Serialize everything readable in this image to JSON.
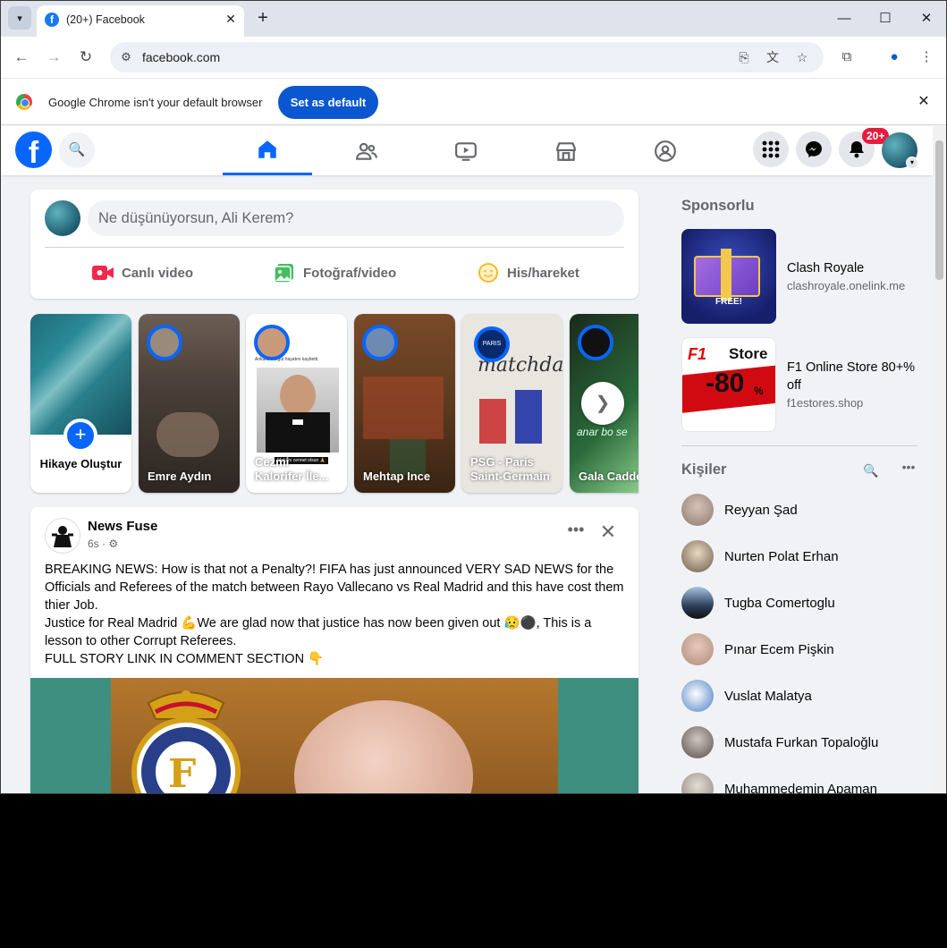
{
  "browser": {
    "tab_title": "(20+) Facebook",
    "url": "facebook.com",
    "infobar_text": "Google Chrome isn't your default browser",
    "set_default_label": "Set as default"
  },
  "facebook": {
    "notification_badge": "20+",
    "composer_placeholder": "Ne düşünüyorsun, Ali Kerem?",
    "composer_actions": [
      "Canlı video",
      "Fotoğraf/video",
      "His/hareket"
    ],
    "create_story_label": "Hikaye Oluştur",
    "stories": [
      {
        "name": "Emre Aydın"
      },
      {
        "name": "Cezmi Kalorifer İle..."
      },
      {
        "name": "Mehtap Ince"
      },
      {
        "name": "PSG - Paris Saint-Germain"
      },
      {
        "name": "Gala Cadde"
      }
    ],
    "story_overlay_texts": {
      "psg_badge": "PARIS",
      "psg_doodle": "matchday",
      "gala_text": "anar bo se",
      "cezmi_caption": "Ankara' Turgut hayatını kaybetti.",
      "cezmi_sticker": "Mekanı cennet olsun 🙏"
    },
    "post": {
      "author": "News Fuse",
      "time": "6s",
      "text_lines": [
        "BREAKING NEWS: How is that not a Penalty?! FIFA has just announced VERY SAD NEWS for the Officials and Referees of the match between Rayo Vallecano vs Real Madrid and this have cost them thier Job.",
        "Justice for Real Madrid 💪We are glad now that justice has now been given out 😥⚫, This is a lesson to other Corrupt Referees.",
        "FULL STORY LINK IN COMMENT SECTION 👇"
      ]
    },
    "sponsored_title": "Sponsorlu",
    "ads": [
      {
        "name": "Clash Royale",
        "url": "clashroyale.onelink.me",
        "image_texts": [
          "FREE!"
        ]
      },
      {
        "name": "F1 Online Store 80+% off",
        "url": "f1estores.shop",
        "image_texts": [
          "F1",
          "Store",
          "-80",
          "%"
        ]
      }
    ],
    "contacts_title": "Kişiler",
    "contacts": [
      {
        "name": "Reyyan Şad"
      },
      {
        "name": "Nurten Polat Erhan"
      },
      {
        "name": "Tugba Comertoglu"
      },
      {
        "name": "Pınar Ecem Pişkin"
      },
      {
        "name": "Vuslat Malatya"
      },
      {
        "name": "Mustafa Furkan Topaloğlu"
      },
      {
        "name": "Muhammedemin Apaman"
      }
    ]
  },
  "colors": {
    "fb_blue": "#0866ff",
    "chrome_blue": "#0b57d0",
    "badge_red": "#e41e3f"
  }
}
